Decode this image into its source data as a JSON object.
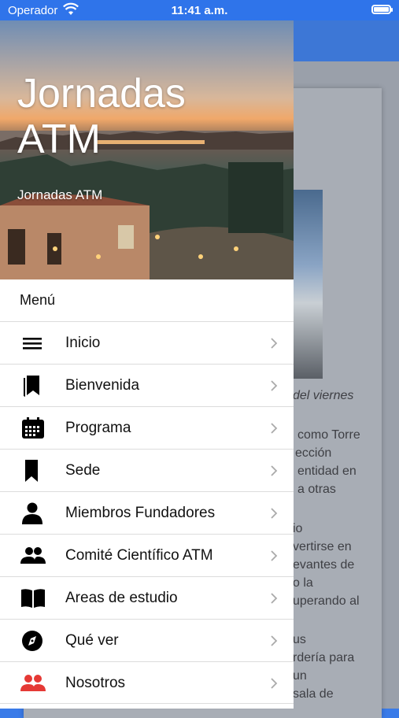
{
  "status_bar": {
    "carrier": "Operador",
    "time": "11:41 a.m."
  },
  "header": {
    "title": "Jornadas ATM",
    "subtitle": "Jornadas ATM"
  },
  "menu": {
    "section_label": "Menú",
    "items": [
      {
        "label": "Inicio",
        "icon": "hamburger-menu-icon"
      },
      {
        "label": "Bienvenida",
        "icon": "bookmarks-icon"
      },
      {
        "label": "Programa",
        "icon": "calendar-icon"
      },
      {
        "label": "Sede",
        "icon": "bookmark-icon"
      },
      {
        "label": "Miembros Fundadores",
        "icon": "person-icon"
      },
      {
        "label": "Comité Científico ATM",
        "icon": "people-icon"
      },
      {
        "label": "Areas de estudio",
        "icon": "open-book-icon"
      },
      {
        "label": "Qué ver",
        "icon": "compass-icon"
      },
      {
        "label": "Nosotros",
        "icon": "group-icon"
      }
    ]
  },
  "background_content": {
    "lines": [
      "del viernes",
      "como Torre",
      "ección",
      "entidad en",
      "a otras",
      "io",
      "vertirse en",
      "evantes de",
      "o la",
      "uperando al",
      "us",
      "rdería para",
      "un",
      "sala de"
    ]
  },
  "colors": {
    "accent": "#2f74ea",
    "nosotros_icon": "#e53935"
  }
}
